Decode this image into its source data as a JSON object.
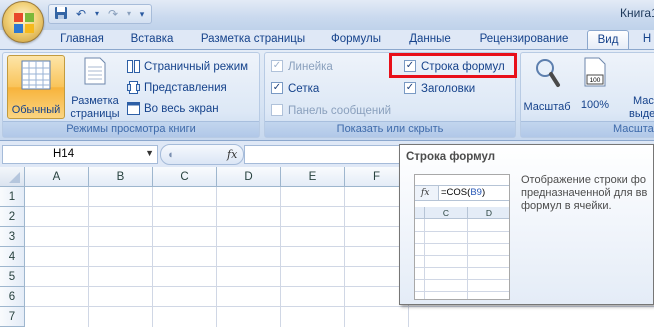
{
  "window": {
    "title": "Книга1"
  },
  "tabs": [
    "Главная",
    "Вставка",
    "Разметка страницы",
    "Формулы",
    "Данные",
    "Рецензирование",
    "Вид",
    "Н"
  ],
  "active_tab": "Вид",
  "ribbon": {
    "views": {
      "normal_label": "Обычный",
      "page_layout_label": "Разметка страницы",
      "page_layout_line1": "Разметка",
      "page_layout_line2": "страницы",
      "page_break_label": "Страничный режим",
      "custom_views_label": "Представления",
      "full_screen_label": "Во весь экран",
      "group_label": "Режимы просмотра книги"
    },
    "show_hide": {
      "ruler_label": "Линейка",
      "gridlines_label": "Сетка",
      "message_bar_label": "Панель сообщений",
      "formula_bar_label": "Строка формул",
      "headings_label": "Заголовки",
      "ruler_checked": true,
      "gridlines_checked": true,
      "message_bar_checked": false,
      "formula_bar_checked": true,
      "headings_checked": true,
      "group_label": "Показать или скрыть"
    },
    "zoom": {
      "zoom_label": "Масштаб",
      "zoom100_label": "100%",
      "zoom100_icon_text": "100",
      "zoom_selection_line1": "Масш",
      "zoom_selection_line2": "выделе",
      "group_label": "Масштаб"
    }
  },
  "formula_bar": {
    "name_box": "H14",
    "fx_label": "fx",
    "formula": ""
  },
  "sheet": {
    "columns": [
      "A",
      "B",
      "C",
      "D",
      "E",
      "F"
    ],
    "rows": [
      "1",
      "2",
      "3",
      "4",
      "5",
      "6",
      "7"
    ]
  },
  "tooltip": {
    "title": "Строка формул",
    "description_lines": [
      "Отображение строки фо",
      "предназначенной для вв",
      "формул в ячейки."
    ],
    "example_fx": "fx",
    "example_formula_prefix": "=COS(",
    "example_formula_ref": "B9",
    "example_formula_suffix": ")",
    "example_columns": [
      "C",
      "D"
    ]
  },
  "colors": {
    "highlight_border": "#e8101a",
    "ribbon_text": "#15428b"
  }
}
